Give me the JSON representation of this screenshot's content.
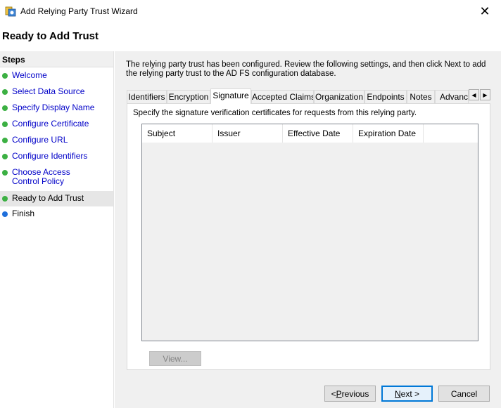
{
  "window": {
    "title": "Add Relying Party Trust Wizard",
    "close_glyph": "✕"
  },
  "page": {
    "title": "Ready to Add Trust"
  },
  "steps": {
    "title": "Steps",
    "items": [
      {
        "label": "Welcome",
        "status": "done"
      },
      {
        "label": "Select Data Source",
        "status": "done"
      },
      {
        "label": "Specify Display Name",
        "status": "done"
      },
      {
        "label": "Configure Certificate",
        "status": "done"
      },
      {
        "label": "Configure URL",
        "status": "done"
      },
      {
        "label": "Configure Identifiers",
        "status": "done"
      },
      {
        "label": "Choose Access Control Policy",
        "status": "done"
      },
      {
        "label": "Ready to Add Trust",
        "status": "current"
      },
      {
        "label": "Finish",
        "status": "pending"
      }
    ]
  },
  "main": {
    "intro": "The relying party trust has been configured. Review the following settings, and then click Next to add the relying party trust to the AD FS configuration database.",
    "tabs": [
      "Identifiers",
      "Encryption",
      "Signature",
      "Accepted Claims",
      "Organization",
      "Endpoints",
      "Notes",
      "Advanced"
    ],
    "active_tab": "Signature",
    "tab_scroll_left": "◀",
    "tab_scroll_right": "▶",
    "signature": {
      "description": "Specify the signature verification certificates for requests from this relying party.",
      "columns": [
        "Subject",
        "Issuer",
        "Effective Date",
        "Expiration Date"
      ],
      "view_button": "View..."
    }
  },
  "buttons": {
    "previous_prefix": "< ",
    "previous_ul": "P",
    "previous_rest": "revious",
    "next_ul": "N",
    "next_rest": "ext >",
    "cancel": "Cancel"
  },
  "colors": {
    "done_dot": "#3cb043",
    "pending_dot": "#1f6fdb",
    "link_text": "#0000c8"
  }
}
